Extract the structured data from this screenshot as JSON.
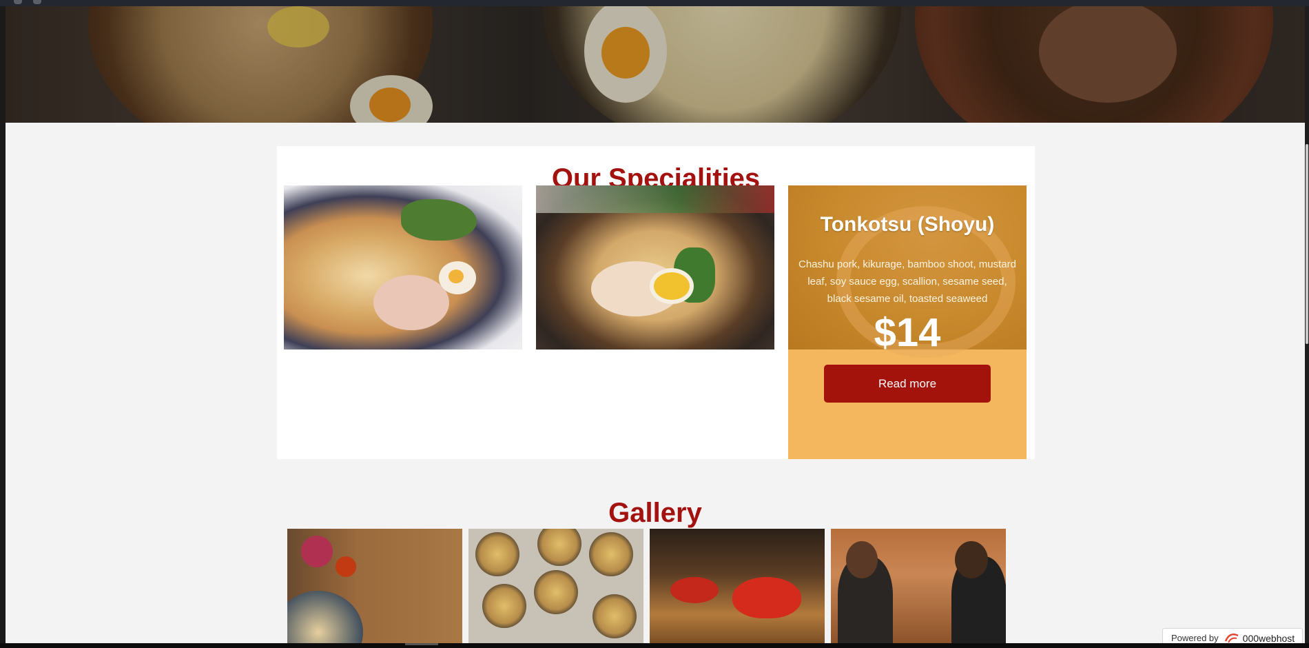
{
  "specialities": {
    "title": "Our Specialities",
    "featured": {
      "name": "Tonkotsu (Shoyu)",
      "description": "Chashu pork, kikurage, bamboo shoot, mustard leaf, soy sauce egg, scallion, sesame seed, black sesame oil, toasted seaweed",
      "price": "$14",
      "button_label": "Read more"
    }
  },
  "gallery": {
    "title": "Gallery"
  },
  "badge": {
    "prefix": "Powered by",
    "brand": "000webhost"
  },
  "colors": {
    "accent": "#a3120e",
    "feature_card": "#f4b75d"
  }
}
